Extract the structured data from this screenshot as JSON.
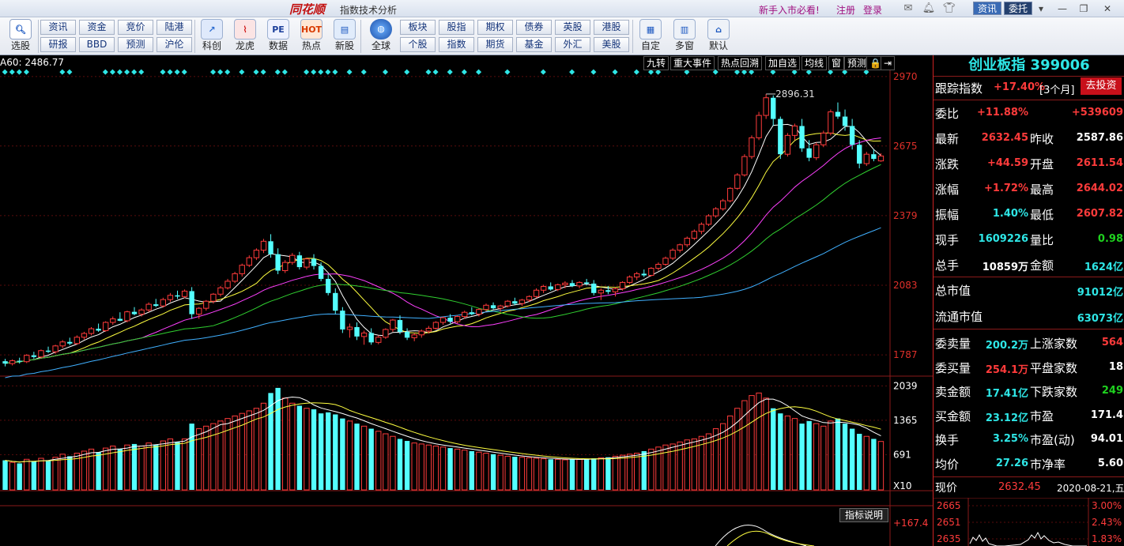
{
  "titlebar": {
    "logo": "同花顺",
    "title": "指数技术分析",
    "promo": "新手入市必看!",
    "register": "注册",
    "login": "登录",
    "btn_zixun": "资讯",
    "btn_weituo": "委托",
    "minimize": "—",
    "restore": "❐",
    "close": "✕"
  },
  "toolbar": {
    "icons_left": [
      {
        "label": "选股",
        "icon": "magnifier-icon"
      }
    ],
    "grid1": [
      [
        "资讯",
        "研报"
      ],
      [
        "资金",
        "BBD"
      ],
      [
        "竞价",
        "预测"
      ],
      [
        "陆港",
        "沪伦"
      ]
    ],
    "icons_mid": [
      {
        "label": "科创",
        "icon": "kechuang-icon",
        "glyph": "↗"
      },
      {
        "label": "龙虎",
        "icon": "longhu-icon",
        "glyph": "⌇"
      },
      {
        "label": "数据",
        "icon": "pe-icon",
        "glyph": "PE"
      },
      {
        "label": "热点",
        "icon": "hot-icon",
        "glyph": "HOT"
      },
      {
        "label": "新股",
        "icon": "newstock-icon",
        "glyph": "▤"
      }
    ],
    "globe": {
      "label": "全球",
      "icon": "globe-icon"
    },
    "grid2": [
      [
        "板块",
        "个股"
      ],
      [
        "股指",
        "指数"
      ],
      [
        "期权",
        "期货"
      ],
      [
        "债券",
        "基金"
      ],
      [
        "英股",
        "外汇"
      ],
      [
        "港股",
        "美股"
      ]
    ],
    "icons_right": [
      {
        "label": "自定",
        "icon": "custom-icon",
        "glyph": "▦"
      },
      {
        "label": "多窗",
        "icon": "multiwindow-icon",
        "glyph": "▥"
      },
      {
        "label": "默认",
        "icon": "home-icon",
        "glyph": "⌂"
      }
    ]
  },
  "chart": {
    "ma_label": "A60: 2486.77",
    "tabs": [
      "九转",
      "重大事件",
      "热点回溯",
      "加自选",
      "均线",
      "窗",
      "预测",
      "🔒",
      "⇥"
    ],
    "price_ticks": [
      "2970",
      "2675",
      "2379",
      "2083",
      "1787"
    ],
    "vol_ticks": [
      "2039",
      "1365",
      "691"
    ],
    "vol_unit": "X10",
    "macd_tick": "+167.4",
    "indicator_btn": "指标说明",
    "peak_label": "2896.31"
  },
  "colors": {
    "up": "#ff3b3b",
    "down": "#54ffff",
    "ma5": "#ffffff",
    "ma10": "#ffff40",
    "ma20": "#ff40ff",
    "ma30": "#30d030",
    "ma60": "#40b0ff"
  },
  "panel": {
    "title": "创业板指 399006",
    "track_label": "跟踪指数",
    "track_value": "+17.40%",
    "track_period": "[3个月]",
    "invest_btn": "去投资",
    "rows": [
      {
        "l1": "委比",
        "v1": "+11.88%",
        "c1": "red",
        "l2": "",
        "v2": "+539609",
        "c2": "red"
      },
      {
        "l1": "最新",
        "v1": "2632.45",
        "c1": "red",
        "l2": "昨收",
        "v2": "2587.86",
        "c2": "white"
      },
      {
        "l1": "涨跌",
        "v1": "+44.59",
        "c1": "red",
        "l2": "开盘",
        "v2": "2611.54",
        "c2": "red"
      },
      {
        "l1": "涨幅",
        "v1": "+1.72%",
        "c1": "red",
        "l2": "最高",
        "v2": "2644.02",
        "c2": "red"
      },
      {
        "l1": "振幅",
        "v1": "1.40%",
        "c1": "cyan",
        "l2": "最低",
        "v2": "2607.82",
        "c2": "red"
      },
      {
        "l1": "现手",
        "v1": "1609226",
        "c1": "cyan",
        "l2": "量比",
        "v2": "0.98",
        "c2": "green"
      },
      {
        "l1": "总手",
        "v1": "10859万",
        "c1": "white",
        "l2": "金额",
        "v2": "1624亿",
        "c2": "cyan"
      }
    ],
    "cap_rows": [
      {
        "l": "总市值",
        "v": "91012亿"
      },
      {
        "l": "流通市值",
        "v": "63073亿"
      }
    ],
    "rows2": [
      {
        "l1": "委卖量",
        "v1": "200.2万",
        "c1": "cyan",
        "l2": "上涨家数",
        "v2": "564",
        "c2": "red"
      },
      {
        "l1": "委买量",
        "v1": "254.1万",
        "c1": "red",
        "l2": "平盘家数",
        "v2": "18",
        "c2": "white"
      },
      {
        "l1": "卖金额",
        "v1": "17.41亿",
        "c1": "cyan",
        "l2": "下跌家数",
        "v2": "249",
        "c2": "green"
      },
      {
        "l1": "买金额",
        "v1": "23.12亿",
        "c1": "cyan",
        "l2": "市盈",
        "v2": "171.4",
        "c2": "white"
      },
      {
        "l1": "换手",
        "v1": "3.25%",
        "c1": "cyan",
        "l2": "市盈(动)",
        "v2": "94.01",
        "c2": "white"
      },
      {
        "l1": "均价",
        "v1": "27.26",
        "c1": "cyan",
        "l2": "市净率",
        "v2": "5.60",
        "c2": "white"
      }
    ],
    "price_label": "现价",
    "price_value": "2632.45",
    "date": "2020-08-21,五",
    "mini_ticks_left": [
      "2665",
      "2651",
      "2635"
    ],
    "mini_ticks_right": [
      "3.00%",
      "2.43%",
      "1.83%"
    ]
  },
  "chart_data": {
    "type": "candlestick",
    "title": "",
    "ylim": [
      1700,
      3000
    ],
    "candles": [
      [
        1760,
        1770,
        1738,
        1750
      ],
      [
        1750,
        1768,
        1742,
        1762
      ],
      [
        1762,
        1775,
        1750,
        1758
      ],
      [
        1758,
        1790,
        1752,
        1785
      ],
      [
        1785,
        1800,
        1770,
        1778
      ],
      [
        1778,
        1810,
        1772,
        1805
      ],
      [
        1805,
        1822,
        1795,
        1800
      ],
      [
        1800,
        1830,
        1792,
        1825
      ],
      [
        1825,
        1850,
        1815,
        1842
      ],
      [
        1842,
        1860,
        1828,
        1835
      ],
      [
        1835,
        1870,
        1830,
        1862
      ],
      [
        1862,
        1885,
        1852,
        1878
      ],
      [
        1878,
        1905,
        1870,
        1898
      ],
      [
        1898,
        1920,
        1885,
        1890
      ],
      [
        1890,
        1930,
        1885,
        1925
      ],
      [
        1925,
        1950,
        1915,
        1940
      ],
      [
        1940,
        1968,
        1930,
        1932
      ],
      [
        1932,
        1975,
        1925,
        1970
      ],
      [
        1970,
        1990,
        1955,
        1960
      ],
      [
        1960,
        1985,
        1950,
        1978
      ],
      [
        1978,
        2010,
        1968,
        2002
      ],
      [
        2002,
        2025,
        1990,
        1995
      ],
      [
        1995,
        2030,
        1988,
        2022
      ],
      [
        2022,
        2050,
        2012,
        2040
      ],
      [
        2040,
        2060,
        2025,
        2035
      ],
      [
        2035,
        2065,
        2028,
        2058
      ],
      [
        2058,
        2075,
        1940,
        1960
      ],
      [
        1960,
        1990,
        1940,
        1985
      ],
      [
        1985,
        2020,
        1975,
        2015
      ],
      [
        2015,
        2050,
        2005,
        2045
      ],
      [
        2045,
        2080,
        2035,
        2072
      ],
      [
        2072,
        2110,
        2065,
        2100
      ],
      [
        2100,
        2140,
        2092,
        2132
      ],
      [
        2132,
        2175,
        2120,
        2168
      ],
      [
        2168,
        2210,
        2160,
        2200
      ],
      [
        2200,
        2240,
        2190,
        2232
      ],
      [
        2232,
        2280,
        2220,
        2270
      ],
      [
        2270,
        2300,
        2200,
        2215
      ],
      [
        2215,
        2240,
        2130,
        2145
      ],
      [
        2145,
        2190,
        2135,
        2180
      ],
      [
        2180,
        2220,
        2170,
        2210
      ],
      [
        2210,
        2225,
        2150,
        2160
      ],
      [
        2160,
        2200,
        2150,
        2195
      ],
      [
        2195,
        2215,
        2150,
        2165
      ],
      [
        2165,
        2180,
        2100,
        2110
      ],
      [
        2110,
        2130,
        2040,
        2050
      ],
      [
        2050,
        2070,
        1960,
        1975
      ],
      [
        1975,
        1990,
        1880,
        1895
      ],
      [
        1895,
        1920,
        1860,
        1905
      ],
      [
        1905,
        1925,
        1850,
        1865
      ],
      [
        1865,
        1890,
        1830,
        1880
      ],
      [
        1880,
        1900,
        1830,
        1840
      ],
      [
        1840,
        1870,
        1832,
        1862
      ],
      [
        1862,
        1900,
        1855,
        1895
      ],
      [
        1895,
        1940,
        1885,
        1935
      ],
      [
        1935,
        1955,
        1875,
        1885
      ],
      [
        1885,
        1900,
        1850,
        1860
      ],
      [
        1860,
        1880,
        1845,
        1872
      ],
      [
        1872,
        1895,
        1860,
        1888
      ],
      [
        1888,
        1910,
        1878,
        1900
      ],
      [
        1900,
        1930,
        1895,
        1925
      ],
      [
        1925,
        1950,
        1915,
        1945
      ],
      [
        1945,
        1960,
        1920,
        1928
      ],
      [
        1928,
        1955,
        1920,
        1950
      ],
      [
        1950,
        1975,
        1940,
        1968
      ],
      [
        1968,
        1990,
        1955,
        1960
      ],
      [
        1960,
        1985,
        1950,
        1980
      ],
      [
        1980,
        2005,
        1972,
        1998
      ],
      [
        1998,
        2010,
        1980,
        1985
      ],
      [
        1985,
        2000,
        1970,
        1995
      ],
      [
        1995,
        2020,
        1988,
        2015
      ],
      [
        2015,
        2030,
        1998,
        2005
      ],
      [
        2005,
        2025,
        1995,
        2020
      ],
      [
        2020,
        2040,
        2012,
        2035
      ],
      [
        2035,
        2070,
        2028,
        2062
      ],
      [
        2062,
        2085,
        2050,
        2078
      ],
      [
        2078,
        2095,
        2060,
        2065
      ],
      [
        2065,
        2090,
        2058,
        2085
      ],
      [
        2085,
        2100,
        2070,
        2092
      ],
      [
        2092,
        2105,
        2075,
        2080
      ],
      [
        2080,
        2100,
        2070,
        2095
      ],
      [
        2095,
        2110,
        2082,
        2090
      ],
      [
        2090,
        2105,
        2040,
        2050
      ],
      [
        2050,
        2070,
        2020,
        2062
      ],
      [
        2062,
        2080,
        2045,
        2055
      ],
      [
        2055,
        2075,
        2035,
        2068
      ],
      [
        2068,
        2100,
        2060,
        2095
      ],
      [
        2095,
        2125,
        2088,
        2118
      ],
      [
        2118,
        2140,
        2105,
        2132
      ],
      [
        2132,
        2150,
        2118,
        2125
      ],
      [
        2125,
        2160,
        2120,
        2155
      ],
      [
        2155,
        2180,
        2145,
        2172
      ],
      [
        2172,
        2205,
        2165,
        2198
      ],
      [
        2198,
        2240,
        2190,
        2232
      ],
      [
        2232,
        2260,
        2222,
        2255
      ],
      [
        2255,
        2290,
        2245,
        2283
      ],
      [
        2283,
        2320,
        2275,
        2312
      ],
      [
        2312,
        2350,
        2300,
        2342
      ],
      [
        2342,
        2385,
        2335,
        2378
      ],
      [
        2378,
        2415,
        2370,
        2408
      ],
      [
        2408,
        2450,
        2400,
        2442
      ],
      [
        2442,
        2500,
        2435,
        2495
      ],
      [
        2495,
        2560,
        2488,
        2552
      ],
      [
        2552,
        2640,
        2545,
        2630
      ],
      [
        2630,
        2720,
        2620,
        2710
      ],
      [
        2710,
        2820,
        2700,
        2805
      ],
      [
        2805,
        2896,
        2790,
        2880
      ],
      [
        2880,
        2890,
        2760,
        2790
      ],
      [
        2790,
        2800,
        2620,
        2640
      ],
      [
        2640,
        2730,
        2630,
        2720
      ],
      [
        2720,
        2770,
        2700,
        2760
      ],
      [
        2760,
        2790,
        2650,
        2665
      ],
      [
        2665,
        2700,
        2610,
        2625
      ],
      [
        2625,
        2690,
        2615,
        2680
      ],
      [
        2680,
        2740,
        2670,
        2730
      ],
      [
        2730,
        2830,
        2720,
        2820
      ],
      [
        2820,
        2860,
        2790,
        2800
      ],
      [
        2800,
        2830,
        2740,
        2760
      ],
      [
        2760,
        2790,
        2660,
        2680
      ],
      [
        2680,
        2700,
        2580,
        2600
      ],
      [
        2600,
        2650,
        2590,
        2640
      ],
      [
        2640,
        2660,
        2610,
        2620
      ],
      [
        2611.54,
        2644.02,
        2607.82,
        2632.45
      ]
    ],
    "volume": [
      580,
      540,
      520,
      600,
      560,
      620,
      580,
      640,
      700,
      660,
      720,
      760,
      800,
      740,
      820,
      860,
      800,
      880,
      900,
      860,
      920,
      880,
      960,
      1000,
      940,
      1000,
      1300,
      1200,
      1250,
      1300,
      1350,
      1400,
      1450,
      1500,
      1550,
      1600,
      1700,
      1900,
      2000,
      1800,
      1700,
      1650,
      1600,
      1580,
      1500,
      1520,
      1480,
      1400,
      1350,
      1300,
      1250,
      1200,
      1150,
      1100,
      1050,
      1000,
      960,
      920,
      900,
      880,
      860,
      840,
      820,
      800,
      780,
      760,
      740,
      720,
      700,
      680,
      660,
      650,
      640,
      630,
      620,
      610,
      600,
      600,
      590,
      600,
      600,
      610,
      620,
      630,
      640,
      660,
      680,
      700,
      720,
      760,
      800,
      840,
      880,
      900,
      940,
      980,
      1000,
      1050,
      1100,
      1200,
      1300,
      1450,
      1600,
      1750,
      1850,
      1900,
      1800,
      1600,
      1500,
      1450,
      1400,
      1300,
      1350,
      1300,
      1250,
      1350,
      1400,
      1300,
      1200,
      1100,
      1050,
      1000,
      950
    ],
    "series_ma_periods": [
      5,
      10,
      20,
      30,
      60
    ]
  }
}
